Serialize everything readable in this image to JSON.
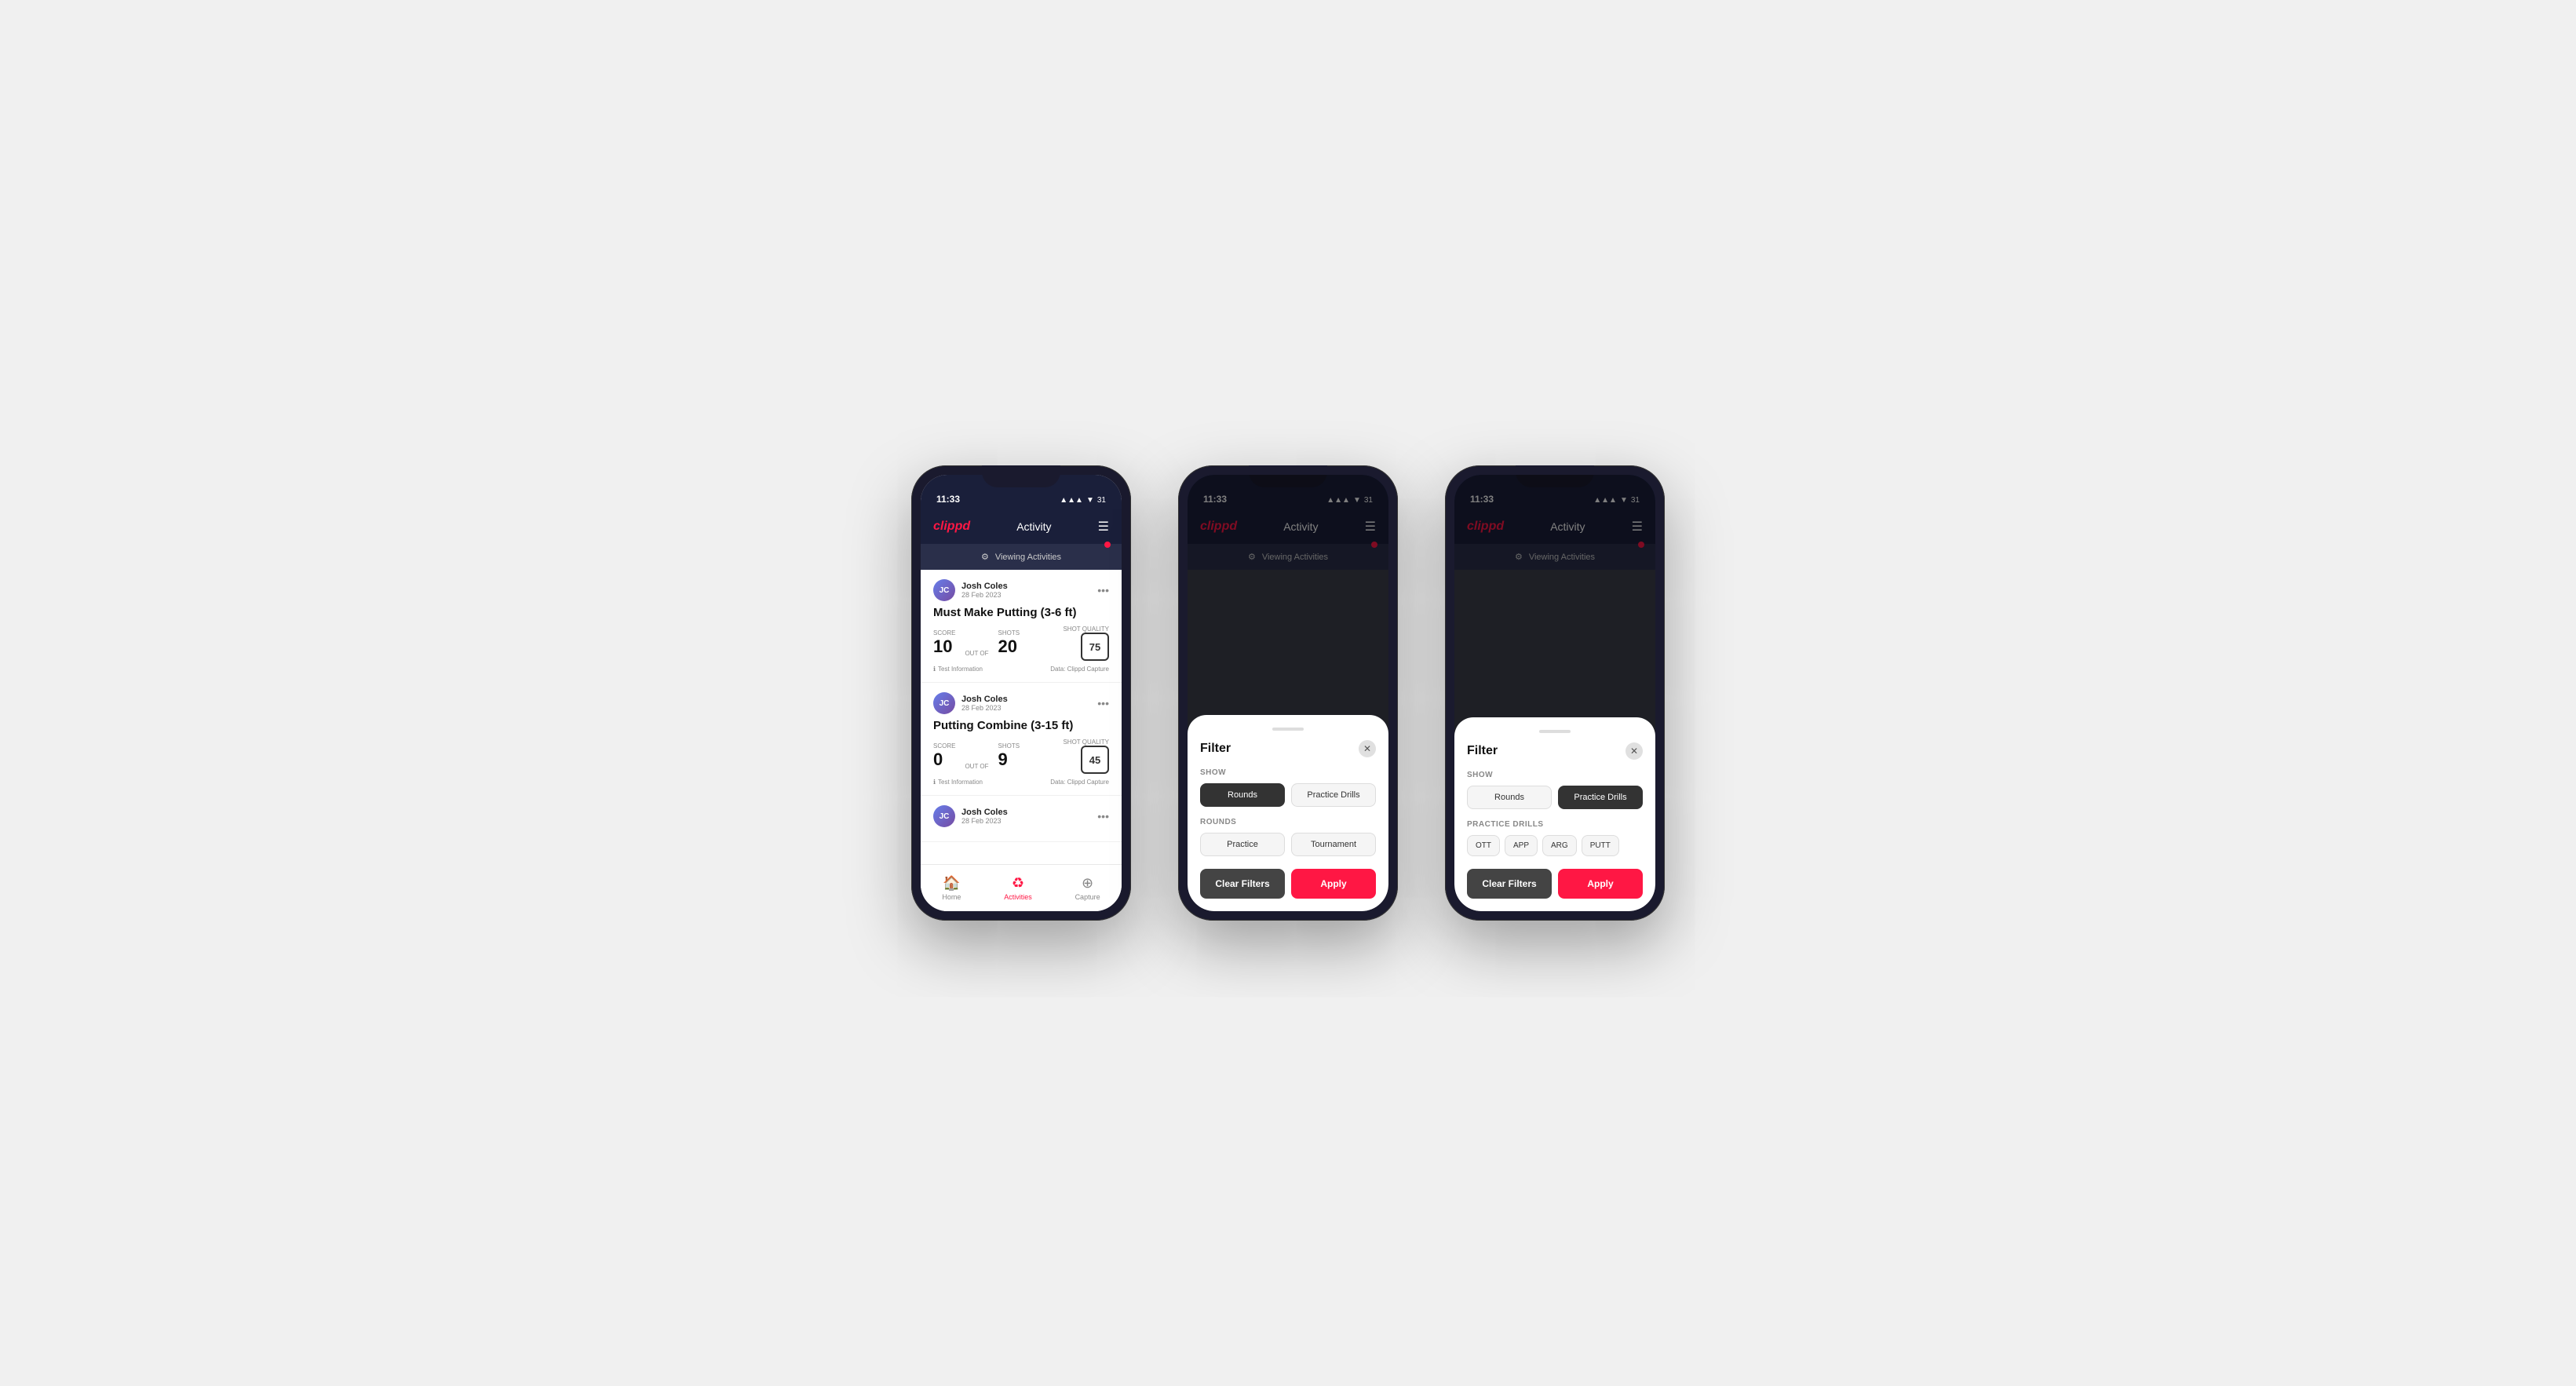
{
  "app": {
    "name": "clippd",
    "nav_title": "Activity",
    "time": "11:33",
    "signal_icons": "▲▲▲ ▼ 31"
  },
  "viewing_bar": {
    "label": "Viewing Activities"
  },
  "cards": [
    {
      "user_name": "Josh Coles",
      "user_date": "28 Feb 2023",
      "title": "Must Make Putting (3-6 ft)",
      "score_label": "Score",
      "score_value": "10",
      "out_of_label": "OUT OF",
      "shots_label": "Shots",
      "shots_value": "20",
      "sq_label": "Shot Quality",
      "sq_value": "75",
      "test_info": "Test Information",
      "data_info": "Data: Clippd Capture"
    },
    {
      "user_name": "Josh Coles",
      "user_date": "28 Feb 2023",
      "title": "Putting Combine (3-15 ft)",
      "score_label": "Score",
      "score_value": "0",
      "out_of_label": "OUT OF",
      "shots_label": "Shots",
      "shots_value": "9",
      "sq_label": "Shot Quality",
      "sq_value": "45",
      "test_info": "Test Information",
      "data_info": "Data: Clippd Capture"
    },
    {
      "user_name": "Josh Coles",
      "user_date": "28 Feb 2023",
      "title": "",
      "score_value": "",
      "shots_value": ""
    }
  ],
  "bottom_nav": [
    {
      "icon": "🏠",
      "label": "Home",
      "active": false
    },
    {
      "icon": "♻",
      "label": "Activities",
      "active": true
    },
    {
      "icon": "⊕",
      "label": "Capture",
      "active": false
    }
  ],
  "filter": {
    "title": "Filter",
    "show_label": "Show",
    "rounds_btn": "Rounds",
    "practice_drills_btn": "Practice Drills",
    "rounds_label": "Rounds",
    "practice_label": "Practice",
    "tournament_label": "Tournament",
    "practice_drills_section_label": "Practice Drills",
    "drill_options": [
      "OTT",
      "APP",
      "ARG",
      "PUTT"
    ],
    "clear_label": "Clear Filters",
    "apply_label": "Apply"
  },
  "phone2": {
    "active_show": "rounds",
    "active_round": "none"
  },
  "phone3": {
    "active_show": "practice_drills",
    "active_drill": "none"
  }
}
